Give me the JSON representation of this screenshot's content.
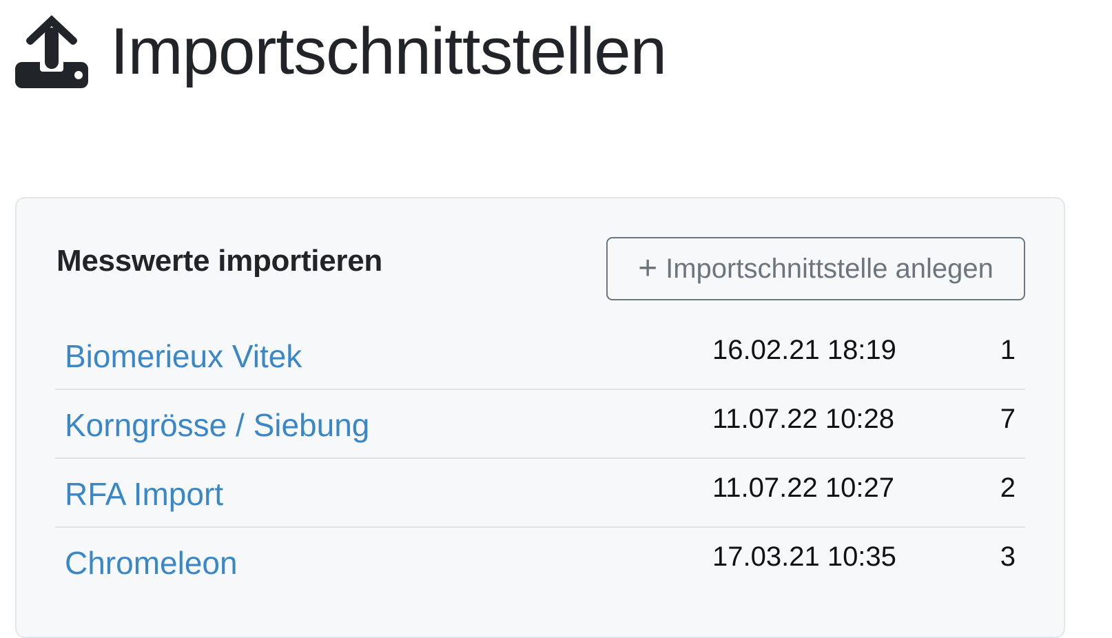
{
  "header": {
    "icon": "upload-icon",
    "title": "Importschnittstellen"
  },
  "card": {
    "title": "Messwerte importieren",
    "add_button": {
      "icon": "plus-icon",
      "plus": "+",
      "label": "Importschnittstelle anlegen"
    },
    "rows": [
      {
        "name": "Biomerieux Vitek",
        "date": "16.02.21 18:19",
        "count": "1"
      },
      {
        "name": "Korngrösse / Siebung",
        "date": "11.07.22 10:28",
        "count": "7"
      },
      {
        "name": "RFA Import",
        "date": "11.07.22 10:27",
        "count": "2"
      },
      {
        "name": "Chromeleon",
        "date": "17.03.21 10:35",
        "count": "3"
      }
    ]
  },
  "colors": {
    "link": "#3a87c8",
    "text": "#212529",
    "button_border": "#6c757d",
    "card_bg": "#f7f8fa"
  }
}
